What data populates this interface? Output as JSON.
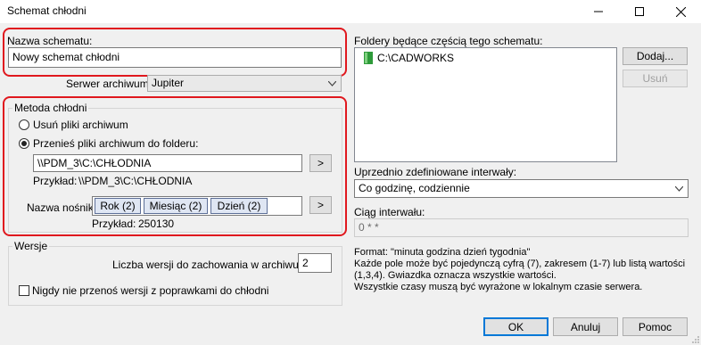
{
  "window": {
    "title": "Schemat chłodni"
  },
  "scheme_name": {
    "label": "Nazwa schematu:",
    "value": "Nowy schemat chłodni"
  },
  "archive_server": {
    "label": "Serwer archiwum:",
    "value": "Jupiter"
  },
  "cold_method": {
    "legend": "Metoda chłodni",
    "delete_option": "Usuń pliki archiwum",
    "move_option": "Przenieś pliki archiwum do folderu:",
    "folder_value": "\\\\PDM_3\\C:\\CHŁODNIA",
    "browse_label": ">",
    "example_label": "Przykład:",
    "example_value": "\\\\PDM_3\\C:\\CHŁODNIA",
    "media_label": "Nazwa nośnika:",
    "media_chips": [
      "Rok (2)",
      "Miesiąc (2)",
      "Dzień (2)"
    ],
    "media_button": ">",
    "media_example_label": "Przykład:",
    "media_example_value": "250130"
  },
  "versions": {
    "legend": "Wersje",
    "keep_label": "Liczba wersji do zachowania w archiwum:",
    "keep_value": "2",
    "never_move_label": "Nigdy nie przenoś wersji z poprawkami do chłodni"
  },
  "folders": {
    "label": "Foldery będące częścią tego schematu:",
    "items": [
      "C:\\CADWORKS"
    ],
    "add_button": "Dodaj...",
    "remove_button": "Usuń"
  },
  "intervals": {
    "label": "Uprzednio zdefiniowane interwały:",
    "value": "Co godzinę, codziennie",
    "string_label": "Ciąg interwału:",
    "string_value": "0 * *",
    "format_lines": [
      "Format: \"minuta godzina dzień tygodnia\"",
      "Każde pole może być pojedynczą cyfrą (7), zakresem (1-7) lub listą wartości",
      "(1,3,4). Gwiazdka oznacza wszystkie wartości.",
      "Wszystkie czasy muszą być wyrażone w lokalnym czasie serwera."
    ]
  },
  "buttons": {
    "ok": "OK",
    "cancel": "Anuluj",
    "help": "Pomoc"
  },
  "colors": {
    "highlight_border": "#e0181e",
    "folder_icon": "#2e9a3a"
  }
}
